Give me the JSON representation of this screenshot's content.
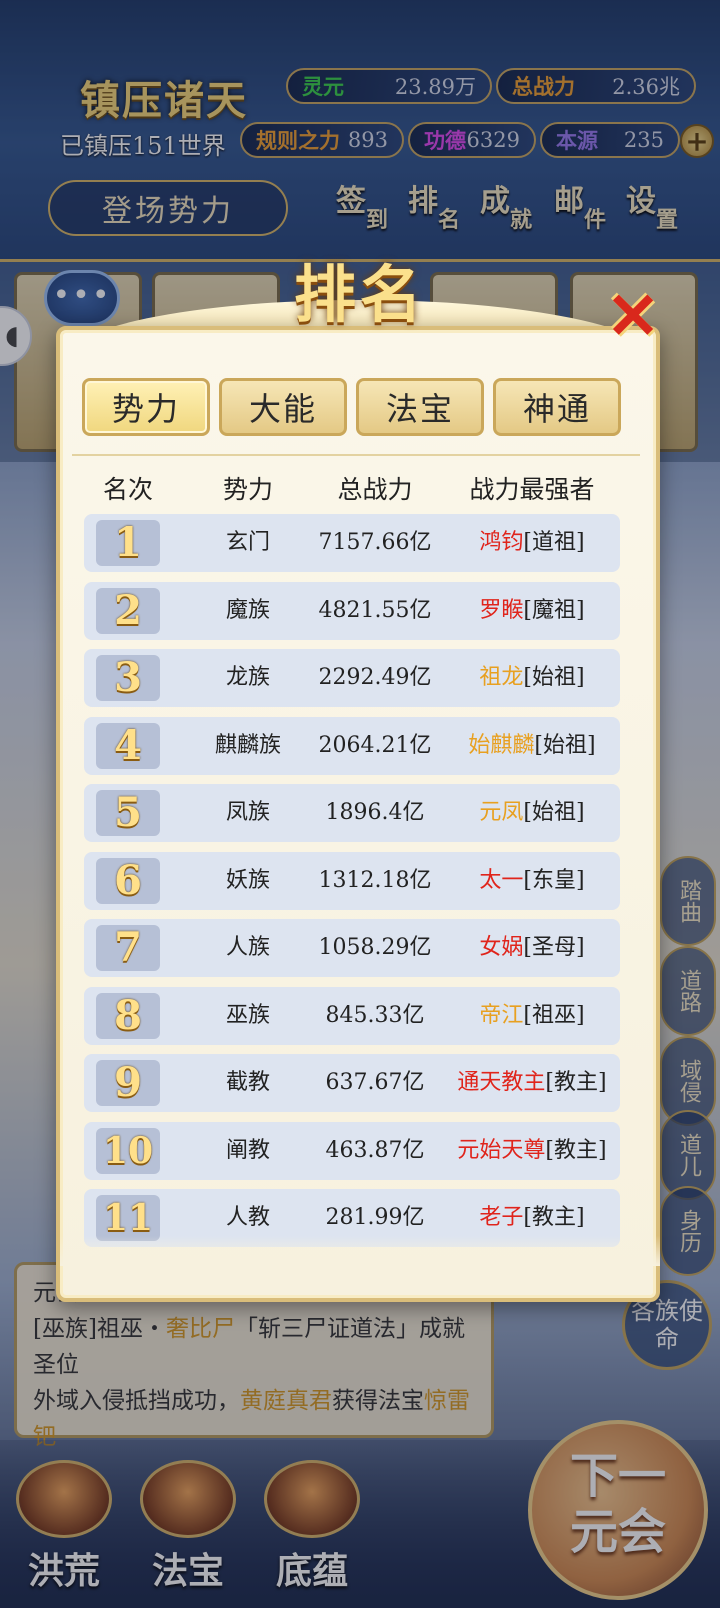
{
  "hud": {
    "game_title": "镇压诸天",
    "worlds_suppressed": "已镇压151世界",
    "resources": [
      {
        "key": "灵元",
        "value": "23.89万",
        "color": "#3bd24a"
      },
      {
        "key": "总战力",
        "value": "2.36兆",
        "color": "#f0a030"
      },
      {
        "key": "规则之力",
        "value": "893",
        "color": "#f0a030"
      },
      {
        "key": "功德",
        "value": "6329",
        "color": "#e04af0"
      },
      {
        "key": "本源",
        "value": "235",
        "color": "#9a7af0"
      }
    ],
    "plus_icon": "plus-icon",
    "enter_faction_label": "登场势力",
    "nav": [
      {
        "big": "签",
        "small": "到"
      },
      {
        "big": "排",
        "small": "名"
      },
      {
        "big": "成",
        "small": "就"
      },
      {
        "big": "邮",
        "small": "件"
      },
      {
        "big": "设",
        "small": "置"
      }
    ],
    "chat_icon": "chat-bubble-icon",
    "chat_dots": "•••"
  },
  "side_buttons": [
    "踏曲",
    "道路",
    "域侵",
    "道儿",
    "身历"
  ],
  "tribe_mission": "各族使命",
  "log": {
    "title": "元会",
    "line1_a": "[巫族]祖巫・",
    "line1_name": "奢比尸",
    "line1_b": "「斩三尸证道法」成就圣位",
    "line2_a": "外域入侵抵挡成功，",
    "line2_name": "黄庭真君",
    "line2_b": "获得法宝",
    "line2_item": "惊雷钯"
  },
  "bottom_nav": [
    "洪荒",
    "法宝",
    "底蕴"
  ],
  "next_era": [
    "下一",
    "元会"
  ],
  "modal": {
    "title": "排名",
    "close_icon": "close-x-icon",
    "tabs": [
      "势力",
      "大能",
      "法宝",
      "神通"
    ],
    "active_tab": 0,
    "columns": [
      "名次",
      "势力",
      "总战力",
      "战力最强者"
    ],
    "rows": [
      {
        "rank": "1",
        "faction": "玄门",
        "power": "7157.66亿",
        "top_name": "鸿钧",
        "top_title": "[道祖]",
        "name_color": "red"
      },
      {
        "rank": "2",
        "faction": "魔族",
        "power": "4821.55亿",
        "top_name": "罗睺",
        "top_title": "[魔祖]",
        "name_color": "red"
      },
      {
        "rank": "3",
        "faction": "龙族",
        "power": "2292.49亿",
        "top_name": "祖龙",
        "top_title": "[始祖]",
        "name_color": "orange"
      },
      {
        "rank": "4",
        "faction": "麒麟族",
        "power": "2064.21亿",
        "top_name": "始麒麟",
        "top_title": "[始祖]",
        "name_color": "orange"
      },
      {
        "rank": "5",
        "faction": "凤族",
        "power": "1896.4亿",
        "top_name": "元凤",
        "top_title": "[始祖]",
        "name_color": "orange"
      },
      {
        "rank": "6",
        "faction": "妖族",
        "power": "1312.18亿",
        "top_name": "太一",
        "top_title": "[东皇]",
        "name_color": "red"
      },
      {
        "rank": "7",
        "faction": "人族",
        "power": "1058.29亿",
        "top_name": "女娲",
        "top_title": "[圣母]",
        "name_color": "red"
      },
      {
        "rank": "8",
        "faction": "巫族",
        "power": "845.33亿",
        "top_name": "帝江",
        "top_title": "[祖巫]",
        "name_color": "orange"
      },
      {
        "rank": "9",
        "faction": "截教",
        "power": "637.67亿",
        "top_name": "通天教主",
        "top_title": "[教主]",
        "name_color": "red"
      },
      {
        "rank": "10",
        "faction": "阐教",
        "power": "463.87亿",
        "top_name": "元始天尊",
        "top_title": "[教主]",
        "name_color": "red"
      },
      {
        "rank": "11",
        "faction": "人教",
        "power": "281.99亿",
        "top_name": "老子",
        "top_title": "[教主]",
        "name_color": "red"
      }
    ]
  }
}
